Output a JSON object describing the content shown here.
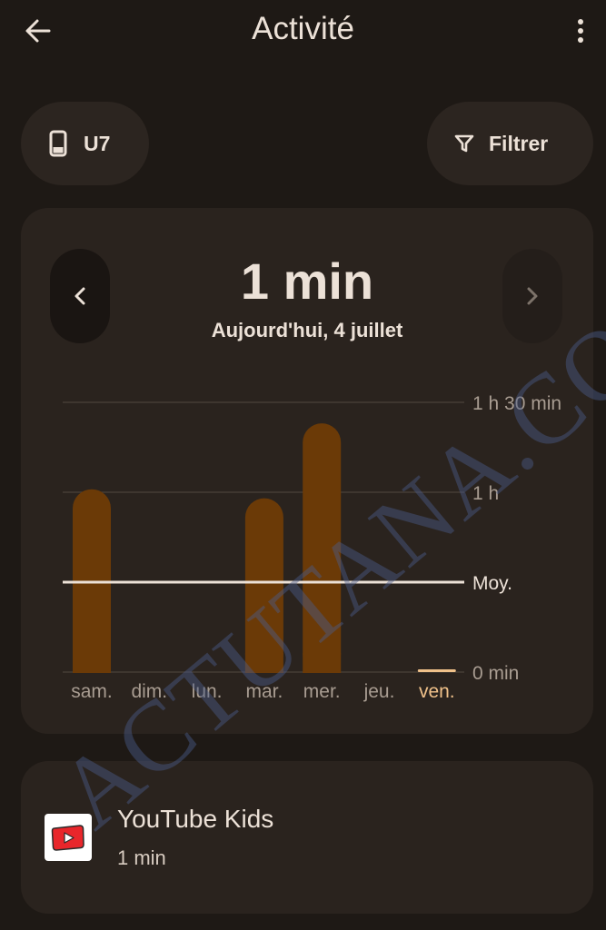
{
  "header": {
    "title": "Activité",
    "back_icon": "arrow-left-icon",
    "more_icon": "more-vert-icon"
  },
  "chips": {
    "device": {
      "label": "U7",
      "icon": "phone-icon"
    },
    "filter": {
      "label": "Filtrer",
      "icon": "filter-icon"
    }
  },
  "summary": {
    "total": "1 min",
    "date": "Aujourd'hui, 4 juillet"
  },
  "chart_data": {
    "type": "bar",
    "categories": [
      "sam.",
      "dim.",
      "lun.",
      "mar.",
      "mer.",
      "jeu.",
      "ven."
    ],
    "values": [
      61,
      0,
      0,
      58,
      83,
      0,
      1
    ],
    "value_unit": "min",
    "y_ticks": [
      {
        "value": 0,
        "label": "0 min"
      },
      {
        "value": 60,
        "label": "1 h"
      },
      {
        "value": 90,
        "label": "1 h 30 min"
      }
    ],
    "average": {
      "value": 30,
      "label": "Moy."
    },
    "ylim": [
      0,
      90
    ],
    "highlight_category": "ven.",
    "colors": {
      "bar": "#6b3a07",
      "bar_highlight": "#f0c18a",
      "grid": "#4a413a",
      "average": "#ece1d7",
      "tick_label": "#a89c91"
    }
  },
  "apps": [
    {
      "name": "YouTube Kids",
      "time": "1 min",
      "icon": "youtube-kids-icon"
    }
  ],
  "watermark": "ACTUTANA.COM"
}
